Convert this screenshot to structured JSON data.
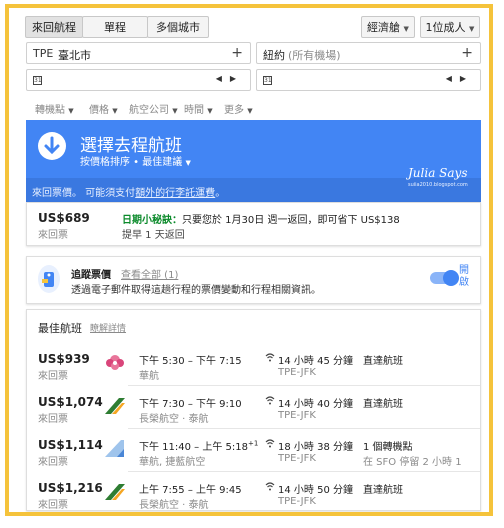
{
  "trip_types": [
    "來回航程",
    "單程",
    "多個城市"
  ],
  "cabin": "經濟艙",
  "passengers": "1位成人",
  "origin_code": "TPE",
  "origin_city": "臺北市",
  "destination_city": "紐約",
  "destination_note": "(所有機場)",
  "date_icon": "31",
  "filters": [
    "轉機點",
    "價格",
    "航空公司",
    "時間",
    "更多"
  ],
  "banner": {
    "title": "選擇去程航班",
    "sort_label": "按價格排序 • 最佳建議",
    "note_prefix": "來回票價。 可能須支付",
    "note_link": "額外的行李託運費",
    "note_suffix": "。",
    "watermark": "Julia Says",
    "watermark_sub": "suiia2010.blogspot.com",
    "color": "#4285f4"
  },
  "tip": {
    "price": "US$689",
    "price_sub": "來回票",
    "label": "日期小秘訣：",
    "text": "只要您於 1月30日 週一返回，即可省下 US$138",
    "sub": "提早 1 天返回",
    "label_color": "#0a8a2a"
  },
  "track": {
    "title": "追蹤票價",
    "link": "查看全部 (1)",
    "desc": "透過電子郵件取得這趟行程的票價變動和行程相關資訊。",
    "toggle_label": "開啟"
  },
  "best": {
    "title": "最佳航班",
    "link": "瞭解詳情",
    "flights": [
      {
        "price": "US$939",
        "sub": "來回票",
        "time": "下午 5:30 – 下午 7:15",
        "sup": "",
        "airline": "華航",
        "duration": "14 小時 45 分鐘",
        "route": "TPE-JFK",
        "stops": "直達航班",
        "stops_sub": "",
        "logo": "china-airlines-logo"
      },
      {
        "price": "US$1,074",
        "sub": "來回票",
        "time": "下午 7:30 – 下午 9:10",
        "sup": "",
        "airline": "長榮航空 · 泰航",
        "duration": "14 小時 40 分鐘",
        "route": "TPE-JFK",
        "stops": "直達航班",
        "stops_sub": "",
        "logo": "eva-air-logo"
      },
      {
        "price": "US$1,114",
        "sub": "來回票",
        "time": "下午 11:40 – 上午 5:18",
        "sup": "+1",
        "airline": "華航, 捷藍航空",
        "duration": "18 小時 38 分鐘",
        "route": "TPE-JFK",
        "stops": "1 個轉機點",
        "stops_sub": "在 SFO 停留 2 小時 1",
        "logo": "jetblue-logo"
      },
      {
        "price": "US$1,216",
        "sub": "來回票",
        "time": "上午 7:55 – 上午 9:45",
        "sup": "",
        "airline": "長榮航空 · 泰航",
        "duration": "14 小時 50 分鐘",
        "route": "TPE-JFK",
        "stops": "直達航班",
        "stops_sub": "",
        "logo": "eva-air-logo"
      }
    ]
  }
}
